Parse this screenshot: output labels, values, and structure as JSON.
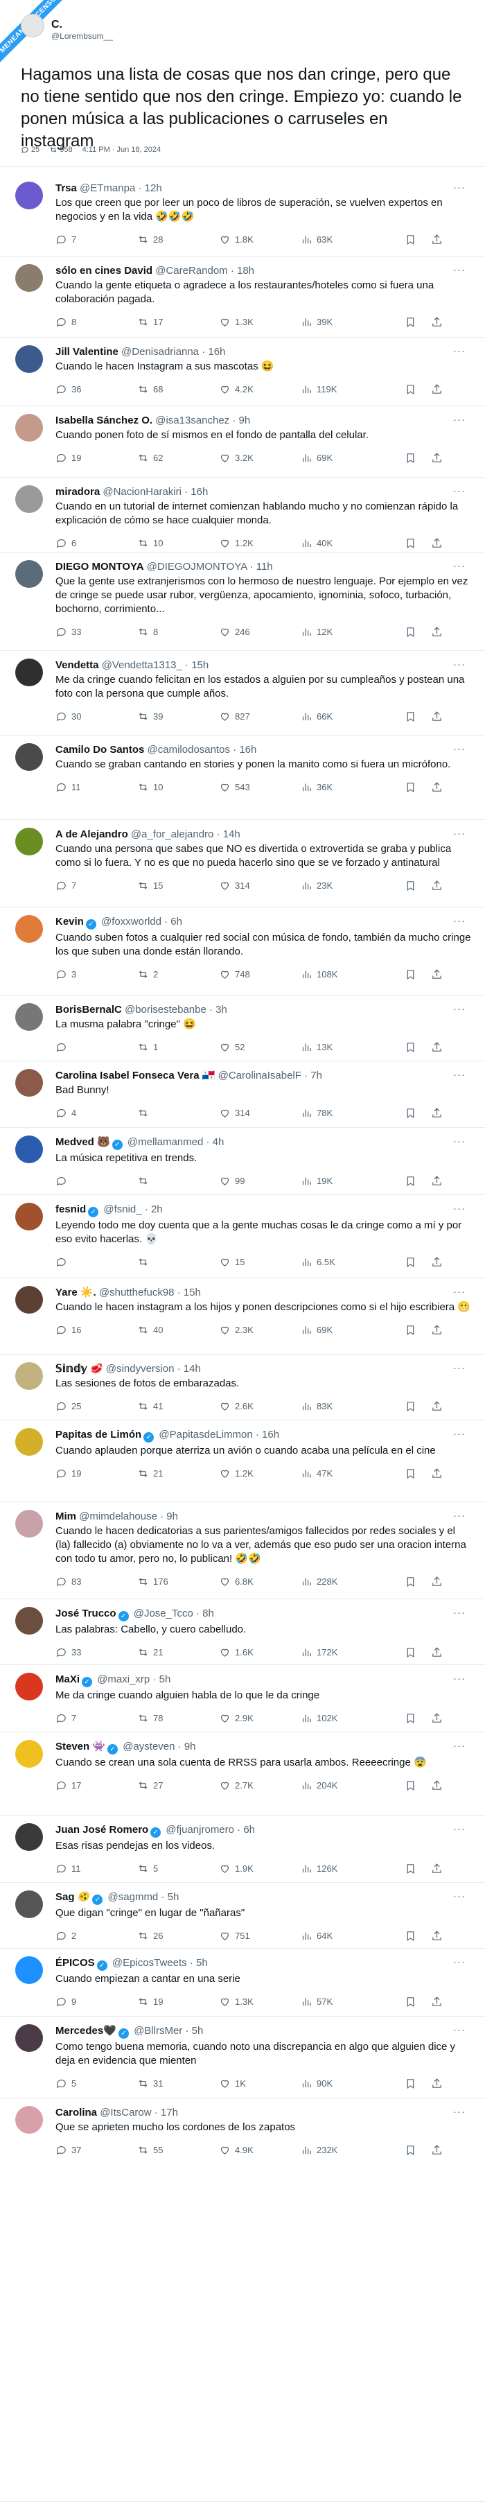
{
  "watermark": "MENEAME/ASCENSO",
  "main": {
    "author_name": "C.",
    "author_handle": "@Lorembsum__",
    "text": "Hagamos una lista de cosas que nos dan cringe, pero que no tiene sentido que nos den cringe. Empiezo yo: cuando le ponen música a las publicaciones o carruseles en instagram",
    "replies": "25",
    "retweets": "958",
    "timestamp": "4:11 PM · Jun 18, 2024"
  },
  "replies": [
    {
      "name": "Trsa",
      "handle": "@ETmanpa",
      "time": "· 12h",
      "text": "Los que creen que por leer un poco de libros de superación, se vuelven expertos en negocios y en la vida 🤣🤣🤣",
      "reply": "7",
      "rt": "28",
      "like": "1.8K",
      "views": "63K",
      "avatar_color": "#6a5acd",
      "verified": false
    },
    {
      "name": "sólo en cines David",
      "handle": "@CareRandom",
      "time": "· 18h",
      "text": "Cuando la gente etiqueta o agradece a los restaurantes/hoteles como si fuera una colaboración pagada.",
      "reply": "8",
      "rt": "17",
      "like": "1.3K",
      "views": "39K",
      "avatar_color": "#8b7d6b",
      "verified": false
    },
    {
      "name": "Jill Valentine",
      "handle": "@Denisadrianna",
      "time": "· 16h",
      "text": "Cuando le hacen Instagram a sus mascotas 😆",
      "reply": "36",
      "rt": "68",
      "like": "4.2K",
      "views": "119K",
      "avatar_color": "#3b5b8c",
      "verified": false
    },
    {
      "name": "Isabella Sánchez O.",
      "handle": "@isa13sanchez",
      "time": "· 9h",
      "text": "Cuando ponen foto de sí mismos en el fondo de pantalla del celular.",
      "reply": "19",
      "rt": "62",
      "like": "3.2K",
      "views": "69K",
      "avatar_color": "#c49a8a",
      "verified": false
    },
    {
      "name": "miradora",
      "handle": "@NacionHarakiri",
      "time": "· 16h",
      "text": "Cuando en un tutorial de internet comienzan hablando mucho y no comienzan rápido la explicación de cómo se hace cualquier monda.",
      "reply": "6",
      "rt": "10",
      "like": "1.2K",
      "views": "40K",
      "avatar_color": "#9a9a9a",
      "verified": false
    },
    {
      "name": "DIEGO MONTOYA",
      "handle": "@DIEGOJMONTOYA",
      "time": "· 11h",
      "text": "Que la gente use extranjerismos con lo hermoso de nuestro lenguaje. Por ejemplo en vez de cringe se puede usar rubor, vergüenza, apocamiento, ignominia, sofoco, turbación, bochorno, corrimiento...",
      "reply": "33",
      "rt": "8",
      "like": "246",
      "views": "12K",
      "avatar_color": "#5a6b7a",
      "verified": false
    },
    {
      "name": "Vendetta",
      "handle": "@Vendetta1313_",
      "time": "· 15h",
      "text": "Me da cringe cuando felicitan en los estados a alguien por su cumpleaños y postean una foto con la persona que cumple años.",
      "reply": "30",
      "rt": "39",
      "like": "827",
      "views": "66K",
      "avatar_color": "#2f2f2f",
      "verified": false
    },
    {
      "name": "Camilo Do Santos",
      "handle": "@camilodosantos",
      "time": "· 16h",
      "text": "Cuando se graban cantando en stories y ponen la manito como si fuera un micrófono.",
      "reply": "11",
      "rt": "10",
      "like": "543",
      "views": "36K",
      "avatar_color": "#4a4a4a",
      "verified": false
    },
    {
      "name": "A de Alejandro",
      "handle": "@a_for_alejandro",
      "time": "· 14h",
      "text": "Cuando una persona que sabes que NO es divertida o extrovertida se graba y publica como si lo fuera. Y no es que no pueda hacerlo sino que se ve forzado y antinatural",
      "reply": "7",
      "rt": "15",
      "like": "314",
      "views": "23K",
      "avatar_color": "#6b8e23",
      "verified": false
    },
    {
      "name": "Kevin",
      "handle": "@foxxworldd",
      "time": "· 6h",
      "text": "Cuando suben fotos a cualquier red social con música de fondo, también da mucho cringe los que suben una donde están llorando.",
      "reply": "3",
      "rt": "2",
      "like": "748",
      "views": "108K",
      "avatar_color": "#e07b39",
      "verified": true
    },
    {
      "name": "BorisBernalC",
      "handle": "@borisestebanbe",
      "time": "· 3h",
      "text": "La musma palabra \"cringe\" 😆",
      "reply": "",
      "rt": "1",
      "like": "52",
      "views": "13K",
      "avatar_color": "#777777",
      "verified": false
    },
    {
      "name": "Carolina Isabel Fonseca Vera 🇵🇦",
      "handle": "@CarolinaIsabelF",
      "time": "· 7h",
      "text": "Bad Bunny!",
      "reply": "4",
      "rt": "",
      "like": "314",
      "views": "78K",
      "avatar_color": "#8b5a4a",
      "verified": false
    },
    {
      "name": "Medved 🐻",
      "handle": "@mellamanmed",
      "time": "· 4h",
      "text": "La música repetitiva en trends.",
      "reply": "",
      "rt": "",
      "like": "99",
      "views": "19K",
      "avatar_color": "#2a5db0",
      "verified": true
    },
    {
      "name": "fesnid",
      "handle": "@fsnid_",
      "time": "· 2h",
      "text": "Leyendo todo me doy cuenta que a la gente muchas cosas le da cringe como a mí y por eso evito hacerlas. 💀",
      "reply": "",
      "rt": "",
      "like": "15",
      "views": "6.5K",
      "avatar_color": "#a0522d",
      "verified": true
    },
    {
      "name": "Yare ☀️.",
      "handle": "@shutthefuck98",
      "time": "· 15h",
      "text": "Cuando le hacen instagram a los hijos y ponen descripciones como si el hijo escribiera 😬",
      "reply": "16",
      "rt": "40",
      "like": "2.3K",
      "views": "69K",
      "avatar_color": "#5c4033",
      "verified": false
    },
    {
      "name": "𝕊𝕚𝕟𝕕𝕪 🥩",
      "handle": "@sindyversion",
      "time": "· 14h",
      "text": "Las sesiones de fotos de embarazadas.",
      "reply": "25",
      "rt": "41",
      "like": "2.6K",
      "views": "83K",
      "avatar_color": "#c2b280",
      "verified": false
    },
    {
      "name": "Papitas de Limón",
      "handle": "@PapitasdeLimmon",
      "time": "· 16h",
      "text": "Cuando aplauden porque aterriza un avión o cuando acaba una película en el cine",
      "reply": "19",
      "rt": "21",
      "like": "1.2K",
      "views": "47K",
      "avatar_color": "#d4b02a",
      "verified": true
    },
    {
      "name": "Mim",
      "handle": "@mimdelahouse",
      "time": "· 9h",
      "text": "Cuando le hacen dedicatorias a sus parientes/amigos fallecidos por redes sociales y el (la) fallecido (a) obviamente no lo va a ver, además que eso pudo ser una oracion interna con todo tu amor, pero no, lo publican! 🤣🤣",
      "reply": "83",
      "rt": "176",
      "like": "6.8K",
      "views": "228K",
      "avatar_color": "#c8a2a8",
      "verified": false
    },
    {
      "name": "José Trucco",
      "handle": "@Jose_Tcco",
      "time": "· 8h",
      "text": "Las palabras: Cabello, y cuero cabelludo.",
      "reply": "33",
      "rt": "21",
      "like": "1.6K",
      "views": "172K",
      "avatar_color": "#6b4e3d",
      "verified": true
    },
    {
      "name": "MaXi",
      "handle": "@maxi_xrp",
      "time": "· 5h",
      "text": "Me da cringe cuando alguien habla de lo que le da cringe",
      "reply": "7",
      "rt": "78",
      "like": "2.9K",
      "views": "102K",
      "avatar_color": "#d9381e",
      "verified": true
    },
    {
      "name": "Steven 👾",
      "handle": "@aysteven",
      "time": "· 9h",
      "text": "Cuando se crean una sola cuenta de RRSS para usarla ambos. Reeeecringe 😨",
      "reply": "17",
      "rt": "27",
      "like": "2.7K",
      "views": "204K",
      "avatar_color": "#f0c020",
      "verified": true
    },
    {
      "name": "Juan José Romero",
      "handle": "@fjuanjromero",
      "time": "· 6h",
      "text": "Esas risas pendejas en los videos.",
      "reply": "11",
      "rt": "5",
      "like": "1.9K",
      "views": "126K",
      "avatar_color": "#3a3a3a",
      "verified": true
    },
    {
      "name": "Sag 🫨",
      "handle": "@sagmmd",
      "time": "· 5h",
      "text": "Que digan \"cringe\" en lugar de \"ñañaras\"",
      "reply": "2",
      "rt": "26",
      "like": "751",
      "views": "64K",
      "avatar_color": "#555555",
      "verified": true
    },
    {
      "name": "ÉPICOS",
      "handle": "@EpicosTweets",
      "time": "· 5h",
      "text": "Cuando empiezan a cantar en una serie",
      "reply": "9",
      "rt": "19",
      "like": "1.3K",
      "views": "57K",
      "avatar_color": "#1e90ff",
      "verified": true
    },
    {
      "name": "Mercedes🖤",
      "handle": "@BllrsMer",
      "time": "· 5h",
      "text": "Como tengo buena memoria, cuando noto una discrepancia en algo que alguien dice y deja en evidencia que mienten",
      "reply": "5",
      "rt": "31",
      "like": "1K",
      "views": "90K",
      "avatar_color": "#4b3b47",
      "verified": true
    },
    {
      "name": "Carolina",
      "handle": "@ItsCarow",
      "time": "· 17h",
      "text": "Que se aprieten mucho los cordones de los zapatos",
      "reply": "37",
      "rt": "55",
      "like": "4.9K",
      "views": "232K",
      "avatar_color": "#d8a0a8",
      "verified": false
    }
  ]
}
